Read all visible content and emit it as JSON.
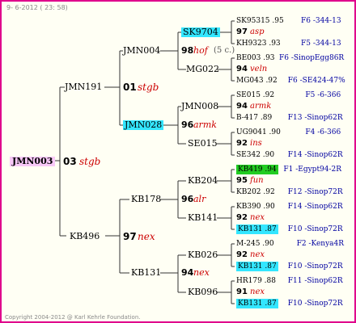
{
  "header": {
    "date": "9- 6-2012 ( 23: 58)"
  },
  "footer": {
    "copyright": "Copyright 2004-2012 @ Karl Kehrle Foundation."
  },
  "root": {
    "name": "JMN003",
    "year": "03",
    "breeder": "stgb"
  },
  "parents": {
    "sire": {
      "name": "JMN191",
      "year": "01",
      "breeder": "stgb"
    },
    "dam": {
      "name": "KB496",
      "year": "97",
      "breeder": "nex"
    }
  },
  "grandparents": [
    {
      "name": "JMN004",
      "year": "98",
      "breeder": "hof",
      "note": "(5 c.)"
    },
    {
      "name": "MG022"
    },
    {
      "name": "JMN008",
      "year": "96",
      "breeder": "armk"
    },
    {
      "name": "SE015"
    },
    {
      "name": "KB204",
      "year": "96",
      "breeder": "alr"
    },
    {
      "name": "KB141"
    },
    {
      "name": "KB026",
      "year": "94",
      "breeder": "nex"
    },
    {
      "name": "KB096"
    }
  ],
  "greatgrandparents": [
    {
      "name": "SK9704"
    },
    {
      "name": "JMN028"
    }
  ],
  "right_groups": [
    {
      "top": "SK95315 .95",
      "top_id": "F6 -344-13",
      "year": "97",
      "breeder": "asp",
      "bottom": "KH9323 .93",
      "bottom_id": "F5 -344-13"
    },
    {
      "top": "BE003 .93",
      "top_id": "F6 -SinopEgg86R",
      "year": "94",
      "breeder": "veln",
      "bottom": "MG043 .92",
      "bottom_id": "F6 -SE424-47%"
    },
    {
      "top": "SE015 .92",
      "top_id": "F5 -6-366",
      "year": "94",
      "breeder": "armk",
      "bottom": "B-417 .89",
      "bottom_id": "F13 -Sinop62R"
    },
    {
      "top": "UG9041 .90",
      "top_id": "F4 -6-366",
      "year": "92",
      "breeder": "ins",
      "bottom": "SE342 .90",
      "bottom_id": "F14 -Sinop62R"
    },
    {
      "top": "KB419 .94",
      "top_id": "F1 -Egypt94-2R",
      "year": "95",
      "breeder": "fun",
      "bottom": "KB202 .92",
      "bottom_id": "F12 -Sinop72R"
    },
    {
      "top": "KB390 .90",
      "top_id": "F14 -Sinop62R",
      "year": "92",
      "breeder": "nex",
      "bottom": "KB131 .87",
      "bottom_id": "F10 -Sinop72R"
    },
    {
      "top": "M-245 .90",
      "top_id": "F2 -Kenya4R",
      "year": "92",
      "breeder": "nex",
      "bottom": "KB131 .87",
      "bottom_id": "F10 -Sinop72R"
    },
    {
      "top": "HR179 .88",
      "top_id": "F11 -Sinop62R",
      "year": "91",
      "breeder": "nex",
      "bottom": "KB131 .87",
      "bottom_id": "F10 -Sinop72R"
    }
  ],
  "colors": {
    "frame": "#e0008c",
    "highlight_cyan": "#33e6ff",
    "highlight_green": "#22cc22",
    "root_pink": "#f7c8f7",
    "breeder": "#cc0000",
    "ids": "#0000a0"
  }
}
